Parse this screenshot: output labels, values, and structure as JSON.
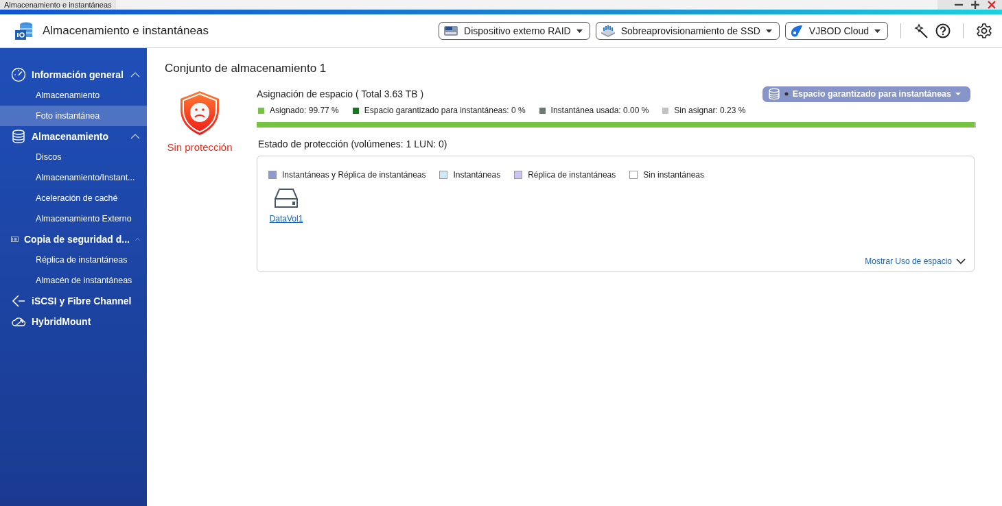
{
  "window": {
    "title": "Almacenamiento e instantáneas"
  },
  "header": {
    "app_title": "Almacenamiento e instantáneas",
    "dropdowns": [
      {
        "label": "Dispositivo externo RAID",
        "kind": "raid"
      },
      {
        "label": "Sobreaprovisionamiento de SSD",
        "kind": "ssd"
      },
      {
        "label": "VJBOD Cloud",
        "kind": "cloud"
      }
    ]
  },
  "sidebar": {
    "items": [
      {
        "label": "Información general",
        "kind": "gauge",
        "expanded": true,
        "children": [
          {
            "label": "Almacenamiento",
            "selected": false
          },
          {
            "label": "Foto instantánea",
            "selected": true
          }
        ]
      },
      {
        "label": "Almacenamiento",
        "kind": "database",
        "expanded": true,
        "children": [
          {
            "label": "Discos",
            "selected": false
          },
          {
            "label": "Almacenamiento/Instant...",
            "selected": false
          },
          {
            "label": "Aceleración de caché",
            "selected": false
          },
          {
            "label": "Almacenamiento Externo",
            "selected": false
          }
        ]
      },
      {
        "label": "Copia de seguridad d...",
        "kind": "camera",
        "expanded": true,
        "children": [
          {
            "label": "Réplica de instantáneas",
            "selected": false
          },
          {
            "label": "Almacén de instantáneas",
            "selected": false
          }
        ]
      },
      {
        "label": "iSCSI y Fibre Channel",
        "kind": "iscsi"
      },
      {
        "label": "HybridMount",
        "kind": "cloudmount"
      }
    ]
  },
  "main": {
    "title": "Conjunto de almacenamiento 1",
    "status": {
      "label": "Sin protección"
    },
    "allocation": {
      "title": "Asignación de espacio ( Total 3.63 TB )",
      "filter": "Espacio garantizado para instantáneas",
      "legend": [
        {
          "label": "Asignado: 99.77 %",
          "color": "#76c442",
          "level": 0.9977
        },
        {
          "label": "Espacio garantizado para instantáneas: 0 %",
          "color": "#17761f",
          "level": 0
        },
        {
          "label": "Instantánea usada: 0.00 %",
          "color": "#6b7a6e",
          "level": 0
        },
        {
          "label": "Sin asignar: 0.23 %",
          "color": "#c2c2c2",
          "level": 0.0023
        }
      ]
    },
    "protection": {
      "title": "Estado de protección (volúmenes: 1 LUN: 0)",
      "legend": [
        {
          "label": "Instantáneas y Réplica de instantáneas",
          "color": "#8c9ccc"
        },
        {
          "label": "Instantáneas",
          "color": "#cfe8f7"
        },
        {
          "label": "Réplica de instantáneas",
          "color": "#cbc4f2"
        },
        {
          "label": "Sin instantáneas",
          "color": "#ffffff"
        }
      ],
      "volumes": [
        {
          "name": "DataVol1"
        }
      ],
      "show_usage": "Mostrar Uso de espacio"
    }
  }
}
